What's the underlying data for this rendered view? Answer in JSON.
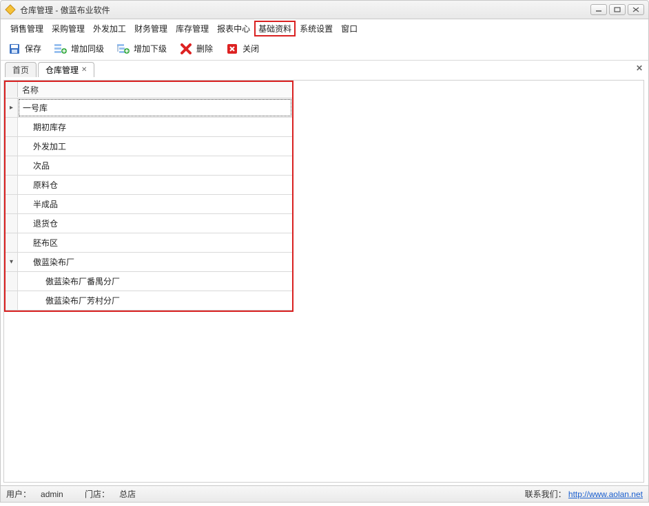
{
  "window": {
    "title": "仓库管理 - 傲蓝布业软件"
  },
  "menu": {
    "items": [
      "销售管理",
      "采购管理",
      "外发加工",
      "财务管理",
      "库存管理",
      "报表中心",
      "基础资料",
      "系统设置",
      "窗口"
    ],
    "highlighted_index": 6
  },
  "toolbar": {
    "save": "保存",
    "add_sibling": "增加同级",
    "add_child": "增加下级",
    "delete": "删除",
    "close": "关闭"
  },
  "tabs": {
    "items": [
      {
        "label": "首页",
        "closable": false,
        "active": false
      },
      {
        "label": "仓库管理",
        "closable": true,
        "active": true
      }
    ]
  },
  "grid": {
    "header": "名称",
    "rows": [
      {
        "label": "一号库",
        "indent": 1,
        "selected": true,
        "marker": "▸"
      },
      {
        "label": "期初库存",
        "indent": 1
      },
      {
        "label": "外发加工",
        "indent": 1
      },
      {
        "label": "次品",
        "indent": 1
      },
      {
        "label": "原料仓",
        "indent": 1
      },
      {
        "label": "半成品",
        "indent": 1
      },
      {
        "label": "退货仓",
        "indent": 1
      },
      {
        "label": "胚布区",
        "indent": 1
      },
      {
        "label": "傲蓝染布厂",
        "indent": 1,
        "expander": "▾"
      },
      {
        "label": "傲蓝染布厂番禺分厂",
        "indent": 2
      },
      {
        "label": "傲蓝染布厂芳村分厂",
        "indent": 2
      }
    ]
  },
  "status": {
    "user_label": "用户：",
    "user_value": "admin",
    "store_label": "门店：",
    "store_value": "总店",
    "contact_label": "联系我们：",
    "contact_link": "http://www.aolan.net"
  }
}
